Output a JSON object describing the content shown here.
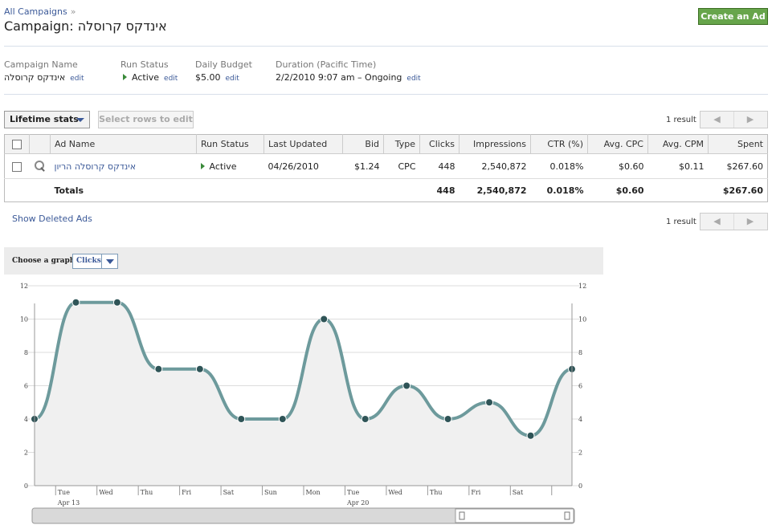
{
  "breadcrumb": {
    "link": "All Campaigns",
    "sep": "»"
  },
  "title": "Campaign: אינדקס קרוסלה",
  "create_ad_label": "Create an Ad",
  "info": {
    "name_label": "Campaign Name",
    "name_value": "אינדקס קרוסלה",
    "status_label": "Run Status",
    "status_value": "Active",
    "budget_label": "Daily Budget",
    "budget_value": "$5.00",
    "duration_label": "Duration (Pacific Time)",
    "duration_value": "2/2/2010 9:07 am – Ongoing",
    "edit": "edit"
  },
  "toolbar": {
    "stats_label": "Lifetime stats",
    "select_rows_label": "Select rows to edit"
  },
  "result_count": "1 result",
  "pager": {
    "prev": "◀",
    "next": "▶"
  },
  "table": {
    "headers": {
      "ad_name": "Ad Name",
      "run_status": "Run Status",
      "last_updated": "Last Updated",
      "bid": "Bid",
      "type": "Type",
      "clicks": "Clicks",
      "impressions": "Impressions",
      "ctr": "CTR (%)",
      "avg_cpc": "Avg. CPC",
      "avg_cpm": "Avg. CPM",
      "spent": "Spent"
    },
    "row": {
      "ad_name": "אינדקס קרוסלה הריון",
      "run_status": "Active",
      "last_updated": "04/26/2010",
      "bid": "$1.24",
      "type": "CPC",
      "clicks": "448",
      "impressions": "2,540,872",
      "ctr": "0.018%",
      "avg_cpc": "$0.60",
      "avg_cpm": "$0.11",
      "spent": "$267.60"
    },
    "totals": {
      "label": "Totals",
      "clicks": "448",
      "impressions": "2,540,872",
      "ctr": "0.018%",
      "avg_cpc": "$0.60",
      "spent": "$267.60"
    }
  },
  "show_deleted": "Show Deleted Ads",
  "graph": {
    "choose_label": "Choose a graph:",
    "selected": "Clicks"
  },
  "chart_data": {
    "type": "line",
    "categories": [
      "Sun",
      "Mon",
      "Tue",
      "Wed",
      "Thu",
      "Fri",
      "Sat",
      "Sun",
      "Mon",
      "Tue",
      "Wed",
      "Thu",
      "Fri",
      "Sat",
      "Sun"
    ],
    "x_tick_labels": [
      "Tue",
      "Wed",
      "Thu",
      "Fri",
      "Sat",
      "Sun",
      "Mon",
      "Tue",
      "Wed",
      "Thu",
      "Fri",
      "Sat"
    ],
    "x_sub_labels": {
      "0": "Apr 13",
      "7": "Apr 20"
    },
    "series": [
      {
        "values": [
          4,
          11,
          11,
          7,
          7,
          4,
          4,
          10,
          4,
          6,
          4,
          5,
          3,
          7
        ]
      }
    ],
    "yticks": [
      0,
      2,
      4,
      6,
      8,
      10,
      12
    ],
    "ylim": [
      0,
      12
    ],
    "grid": true,
    "line_color": "#6d9a9c",
    "point_color": "#2f5457",
    "area_color": "#f0f0f0"
  }
}
